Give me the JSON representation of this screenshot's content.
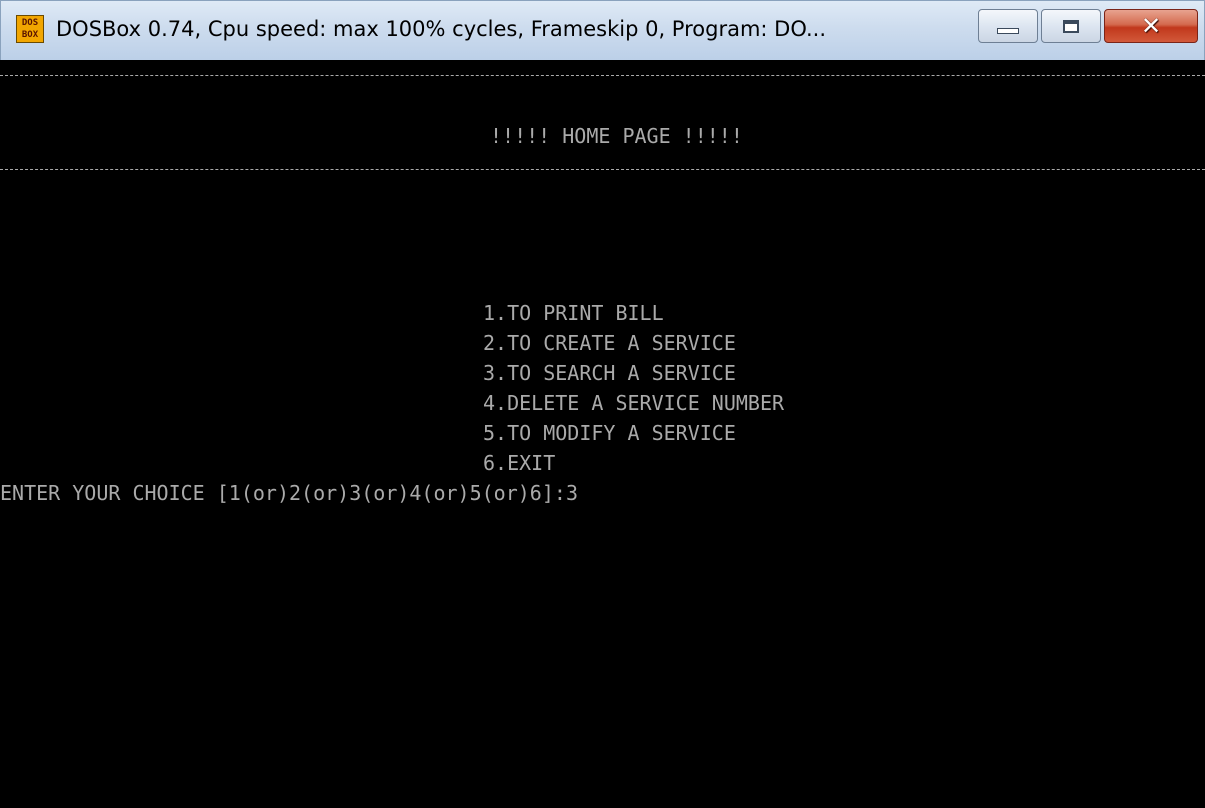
{
  "window": {
    "title": "DOSBox 0.74, Cpu speed: max 100% cycles, Frameskip  0, Program:   DO...",
    "icon": {
      "name": "dosbox-icon",
      "lines": [
        "DOS",
        "BOX"
      ]
    },
    "controls": {
      "minimize": "minimize-icon",
      "maximize": "maximize-icon",
      "close": "close-icon",
      "close_glyph": "✕",
      "close_color": "#c1381c"
    }
  },
  "terminal": {
    "background": "#000000",
    "foreground": "#aaaaaa",
    "header": "!!!!! HOME PAGE !!!!!",
    "menu_items": [
      "1.TO PRINT BILL",
      "2.TO CREATE A SERVICE",
      "3.TO SEARCH A SERVICE",
      "4.DELETE A SERVICE NUMBER",
      "5.TO MODIFY A SERVICE",
      "6.EXIT"
    ],
    "prompt": "ENTER YOUR CHOICE [1(or)2(or)3(or)4(or)5(or)6]:",
    "input_value": "3"
  }
}
